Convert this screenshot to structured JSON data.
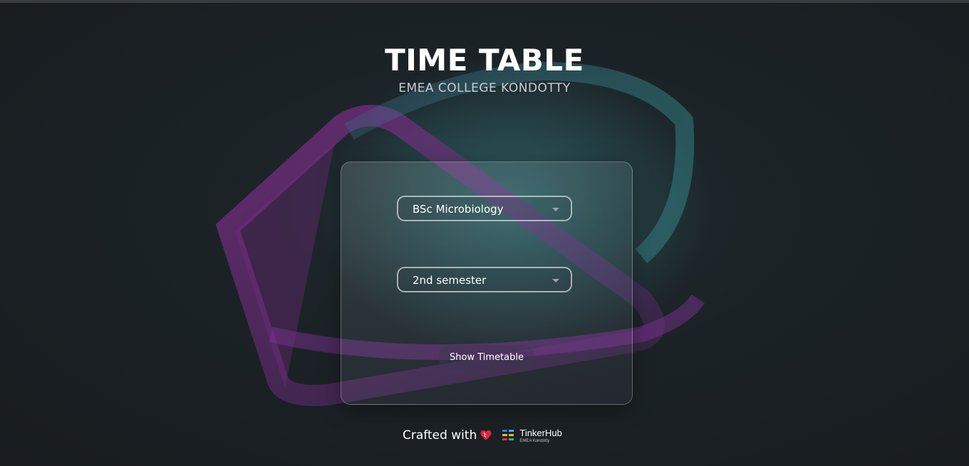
{
  "header": {
    "title": "TIME TABLE",
    "subtitle": "EMEA COLLEGE KONDOTTY"
  },
  "form": {
    "course_value": "BSc Microbiology",
    "semester_value": "2nd semester",
    "submit_label": "Show Timetable"
  },
  "footer": {
    "crafted_text": "Crafted with",
    "brand_name": "TinkerHub",
    "brand_sub": "EMEA Kondotty"
  },
  "colors": {
    "background": "#1b1f22",
    "accent_purple": "#9b3aa8",
    "accent_teal": "#3f9aa0",
    "heart": "#e0263a"
  }
}
